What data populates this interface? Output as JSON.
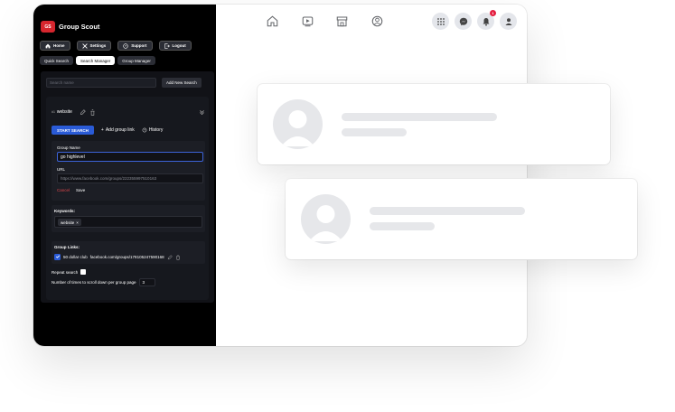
{
  "app": {
    "name": "Group Scout",
    "logo_text": "GS"
  },
  "nav": [
    {
      "label": "Home",
      "icon": "home-icon"
    },
    {
      "label": "Settings",
      "icon": "tools-icon"
    },
    {
      "label": "Support",
      "icon": "support-icon"
    },
    {
      "label": "Logout",
      "icon": "logout-icon"
    }
  ],
  "tabs": [
    {
      "label": "Quick Search",
      "active": false
    },
    {
      "label": "Search Manager",
      "active": true
    },
    {
      "label": "Group Manager",
      "active": false
    }
  ],
  "search": {
    "placeholder": "Search name",
    "add_label": "Add New Search"
  },
  "card": {
    "count": "#1",
    "title": "website",
    "start_label": "START SEARCH",
    "add_group_label": "Add group link",
    "history_label": "History",
    "group_name_label": "Group Name",
    "group_name_value": "go highlevel",
    "url_label": "URL",
    "url_value": "https://www.facebook.com/groups/222355997510163",
    "cancel_label": "Cancel",
    "save_label": "Save",
    "keywords_label": "Keywords:",
    "keywords": [
      "website"
    ],
    "group_links_label": "Group Links:",
    "group_links": [
      {
        "name": "50 dollar club",
        "url": "facebook.com/groups/178105247590168",
        "checked": true
      }
    ],
    "repeat_label": "Repeat search",
    "scroll_label": "Number of times to scroll down per group page",
    "scroll_value": "3"
  },
  "notifications": {
    "count": "1"
  },
  "colors": {
    "accent": "#2a5bd7",
    "brand": "#d6262e",
    "panel": "#000000",
    "danger": "#e0474c",
    "badge": "#e41e3f"
  }
}
